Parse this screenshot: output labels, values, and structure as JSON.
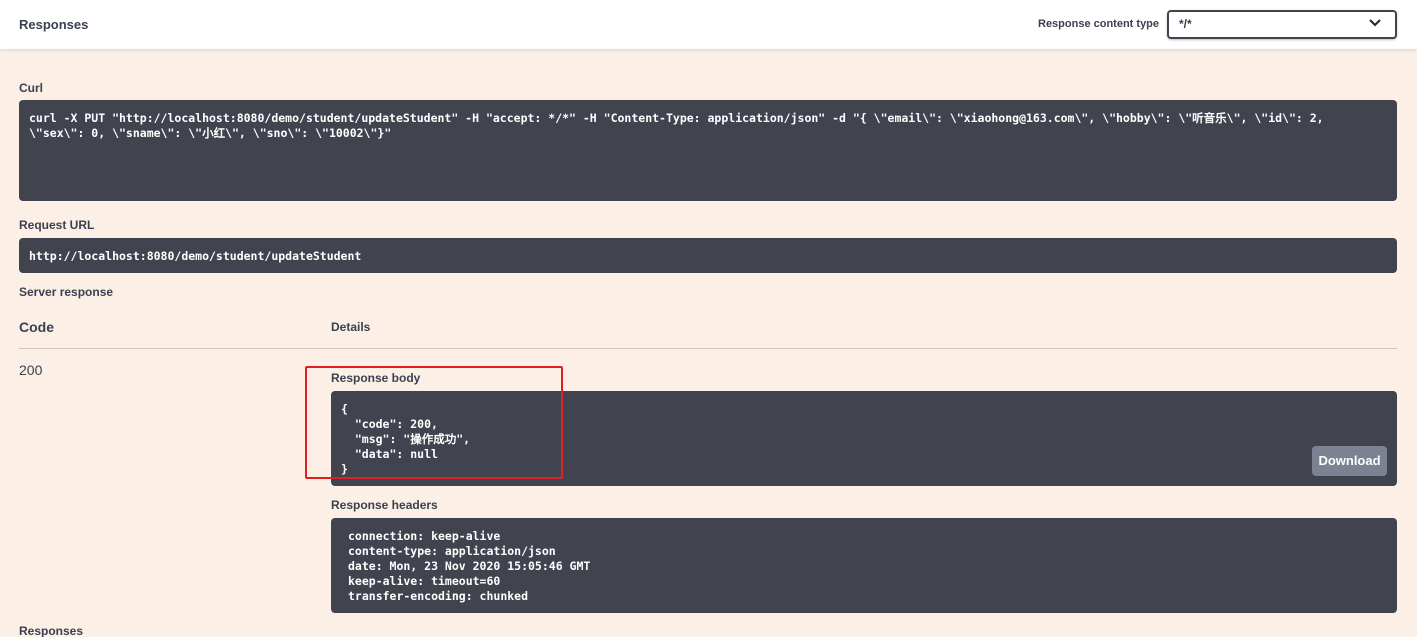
{
  "header": {
    "title": "Responses",
    "content_type_label": "Response content type",
    "content_type_value": "*/*"
  },
  "curl": {
    "label": "Curl",
    "command": "curl -X PUT \"http://localhost:8080/demo/student/updateStudent\" -H \"accept: */*\" -H \"Content-Type: application/json\" -d \"{ \\\"email\\\": \\\"xiaohong@163.com\\\", \\\"hobby\\\": \\\"听音乐\\\", \\\"id\\\": 2,\n\\\"sex\\\": 0, \\\"sname\\\": \\\"小红\\\", \\\"sno\\\": \\\"10002\\\"}\""
  },
  "request_url": {
    "label": "Request URL",
    "value": "http://localhost:8080/demo/student/updateStudent"
  },
  "server_response": {
    "label": "Server response",
    "code_header": "Code",
    "details_header": "Details",
    "status_code": "200",
    "body_label": "Response body",
    "body": "{\n  \"code\": 200,\n  \"msg\": \"操作成功\",\n  \"data\": null\n}",
    "download_label": "Download",
    "headers_label": "Response headers",
    "headers": "connection: keep-alive\ncontent-type: application/json\ndate: Mon, 23 Nov 2020 15:05:46 GMT\nkeep-alive: timeout=60\ntransfer-encoding: chunked"
  },
  "footer": {
    "title": "Responses"
  },
  "colors": {
    "background": "#fcf0e6",
    "code_block": "#41444e",
    "highlight": "#e02020",
    "download_button": "#7d8293"
  }
}
